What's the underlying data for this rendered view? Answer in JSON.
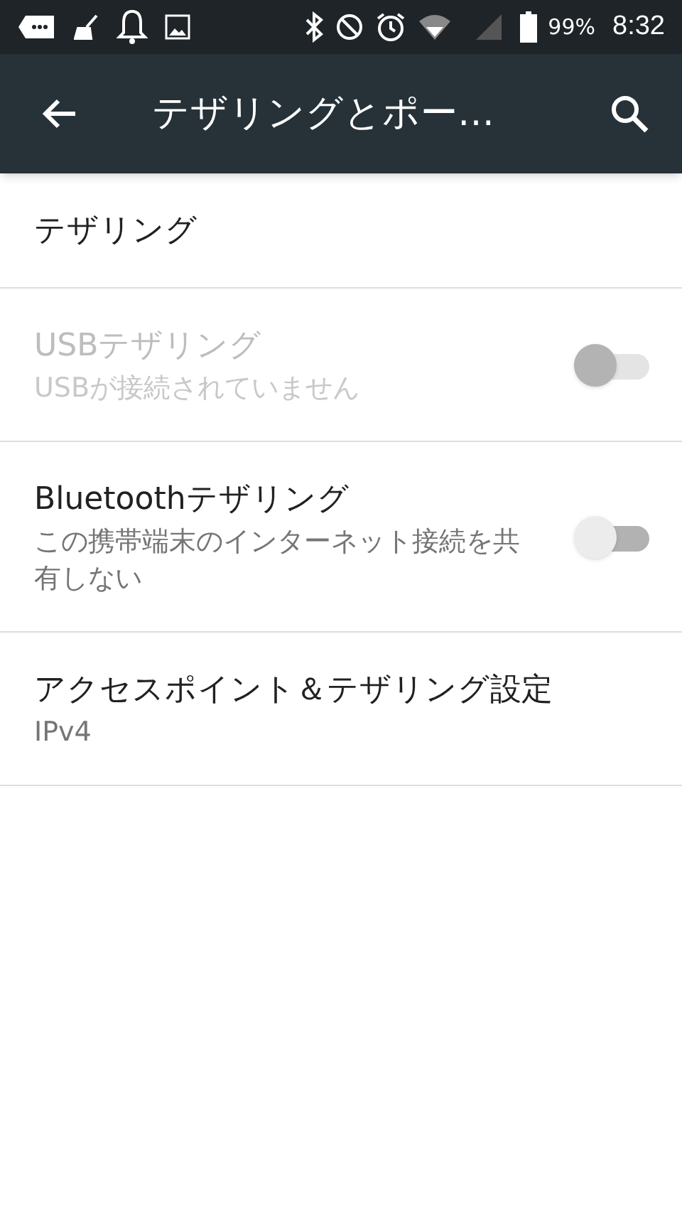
{
  "status_bar": {
    "battery": "99%",
    "time": "8:32"
  },
  "toolbar": {
    "title": "テザリングとポー…"
  },
  "items": [
    {
      "kind": "header",
      "title": "テザリング"
    },
    {
      "kind": "switch",
      "title": "USBテザリング",
      "summary": "USBが接続されていません",
      "disabled": true,
      "on": false
    },
    {
      "kind": "switch",
      "title": "Bluetoothテザリング",
      "summary": "この携帯端末のインターネット接続を共有しない",
      "disabled": false,
      "on": false
    },
    {
      "kind": "plain",
      "title": "アクセスポイント＆テザリング設定",
      "summary": "IPv4"
    }
  ]
}
